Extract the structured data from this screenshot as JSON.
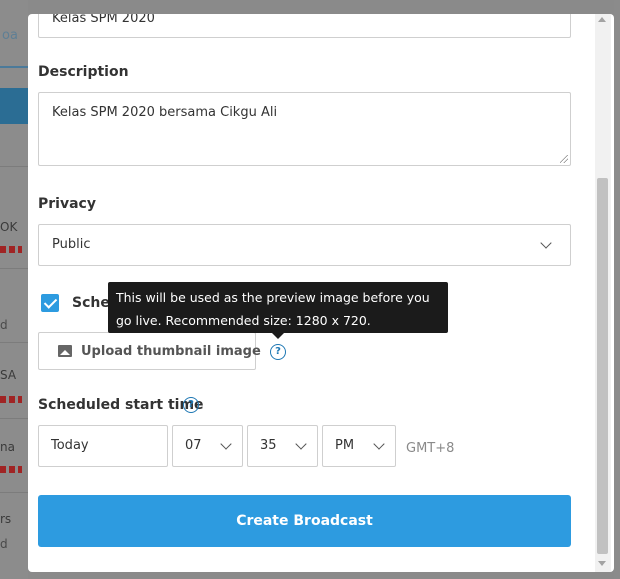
{
  "background": {
    "tab_fragment": "oa",
    "row_fragments": [
      "OK",
      "d",
      "SA",
      "na",
      "rs",
      "d"
    ]
  },
  "modal": {
    "title_value": "Kelas SPM 2020",
    "description": {
      "label": "Description",
      "value": "Kelas SPM 2020 bersama Cikgu Ali"
    },
    "privacy": {
      "label": "Privacy",
      "selected": "Public"
    },
    "schedule": {
      "checkbox_label": "Sched",
      "checked": true
    },
    "tooltip": {
      "text": "This will be used as the preview image before you go live. Recommended size: 1280 x 720."
    },
    "upload": {
      "label": "Upload thumbnail image",
      "icon": "image-icon"
    },
    "start_time": {
      "label": "Scheduled start time",
      "date": "Today",
      "hour": "07",
      "minute": "35",
      "ampm": "PM",
      "timezone": "GMT+8"
    },
    "create_button": "Create Broadcast"
  },
  "colors": {
    "accent": "#2d9be0",
    "help_icon": "#1f78b4",
    "tooltip_bg": "#1b1b1b",
    "overlay": "#8a8a8a"
  }
}
